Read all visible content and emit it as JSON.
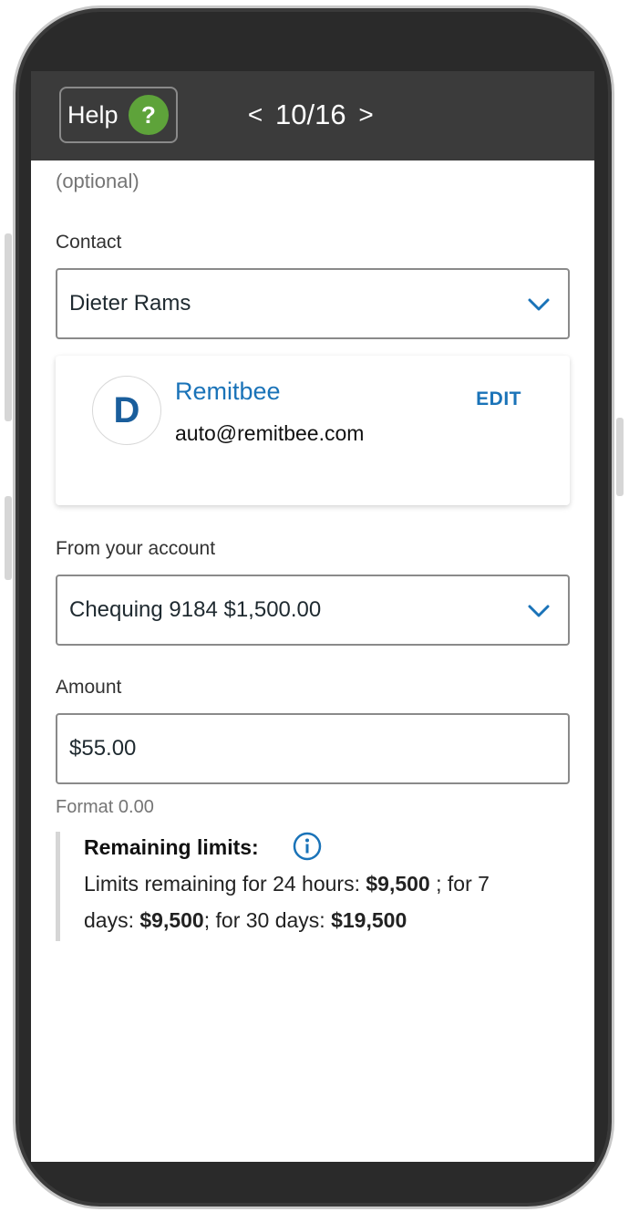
{
  "header": {
    "help_label": "Help",
    "help_icon_glyph": "?",
    "prev_glyph": "<",
    "next_glyph": ">",
    "step_counter": "10/16"
  },
  "form": {
    "optional_hint": "(optional)",
    "contact": {
      "label": "Contact",
      "selected": "Dieter Rams"
    },
    "contact_card": {
      "avatar_initial": "D",
      "name": "Remitbee",
      "email": "auto@remitbee.com",
      "edit_label": "EDIT"
    },
    "from_account": {
      "label": "From your account",
      "selected": "Chequing 9184 $1,500.00"
    },
    "amount": {
      "label": "Amount",
      "value": "$55.00",
      "format_hint": "Format 0.00"
    },
    "limits": {
      "title": "Remaining limits:",
      "line1_prefix": "Limits remaining for 24 hours: ",
      "limit_24h": "$9,500",
      "line1_suffix": " ; for 7",
      "line2_prefix": "days: ",
      "limit_7d": "$9,500",
      "line2_mid": "; for 30 days: ",
      "limit_30d": "$19,500"
    }
  },
  "colors": {
    "accent_blue": "#1a73b8",
    "help_green": "#5ea33a",
    "header_bg": "#3b3b3b"
  }
}
